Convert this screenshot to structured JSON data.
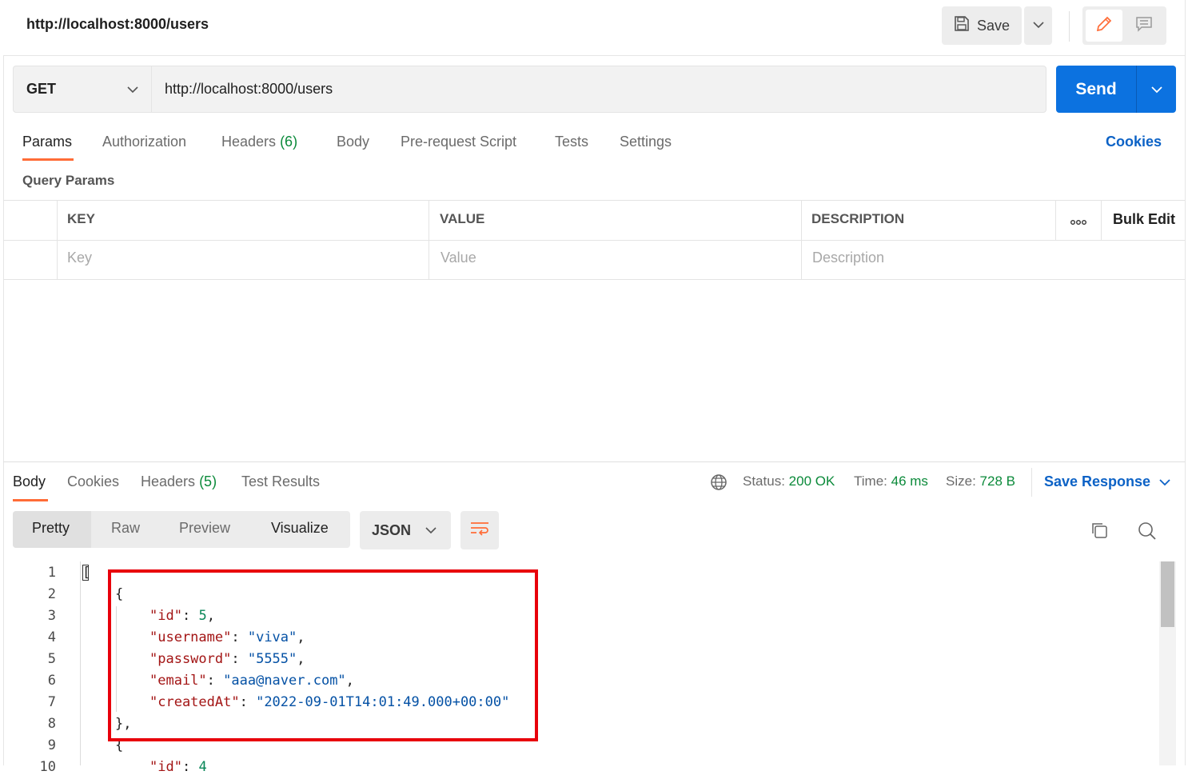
{
  "request": {
    "title": "http://localhost:8000/users",
    "save_label": "Save",
    "method": "GET",
    "url": "http://localhost:8000/users",
    "send_label": "Send",
    "tabs": [
      {
        "label": "Params",
        "count": ""
      },
      {
        "label": "Authorization",
        "count": ""
      },
      {
        "label": "Headers",
        "count": "(6)"
      },
      {
        "label": "Body",
        "count": ""
      },
      {
        "label": "Pre-request Script",
        "count": ""
      },
      {
        "label": "Tests",
        "count": ""
      },
      {
        "label": "Settings",
        "count": ""
      }
    ],
    "cookies_label": "Cookies",
    "query_params_title": "Query Params",
    "table": {
      "headers": [
        "KEY",
        "VALUE",
        "DESCRIPTION"
      ],
      "bulk_edit_label": "Bulk Edit",
      "placeholders": [
        "Key",
        "Value",
        "Description"
      ]
    }
  },
  "response": {
    "tabs": [
      {
        "label": "Body",
        "count": ""
      },
      {
        "label": "Cookies",
        "count": ""
      },
      {
        "label": "Headers",
        "count": "(5)"
      },
      {
        "label": "Test Results",
        "count": ""
      }
    ],
    "status_label": "Status:",
    "status_value": "200 OK",
    "time_label": "Time:",
    "time_value": "46 ms",
    "size_label": "Size:",
    "size_value": "728 B",
    "save_response_label": "Save Response",
    "view_modes": [
      "Pretty",
      "Raw",
      "Preview",
      "Visualize"
    ],
    "format": "JSON",
    "line_numbers": [
      "1",
      "2",
      "3",
      "4",
      "5",
      "6",
      "7",
      "8",
      "9",
      "10"
    ],
    "json": {
      "open_bracket": "[",
      "open_brace": "{",
      "fields": [
        {
          "key": "\"id\"",
          "value": "5",
          "type": "number"
        },
        {
          "key": "\"username\"",
          "value": "\"viva\"",
          "type": "string"
        },
        {
          "key": "\"password\"",
          "value": "\"5555\"",
          "type": "string"
        },
        {
          "key": "\"email\"",
          "value": "\"aaa@naver.com\"",
          "type": "string"
        },
        {
          "key": "\"createdAt\"",
          "value": "\"2022-09-01T14:01:49.000+00:00\"",
          "type": "string"
        }
      ],
      "close_brace": "},",
      "next_open_brace": "{",
      "next_line_partial_key": "\"id\"",
      "next_line_partial_value": "4"
    }
  },
  "icons": [
    "save-icon",
    "chevron-down-icon",
    "pencil-icon",
    "comment-icon",
    "globe-icon",
    "copy-icon",
    "search-icon",
    "wrap-lines-icon",
    "more-dots-icon"
  ],
  "colors": {
    "accent_orange": "#ff6c37",
    "send_blue": "#0c72e0",
    "link_blue": "#0c62c6",
    "status_green": "#0b8a3a",
    "highlight_red": "#e8000b"
  }
}
